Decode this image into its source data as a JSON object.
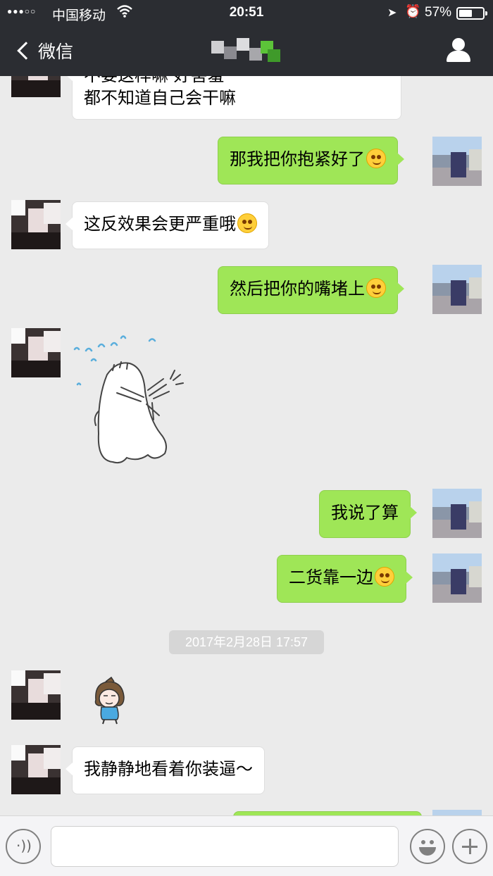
{
  "status": {
    "signal": "●●●○○",
    "carrier": "中国移动",
    "time": "20:51",
    "battery_pct": "57%",
    "battery_level": 0.57
  },
  "nav": {
    "back_label": "微信",
    "title_color_accent": "#5cc439"
  },
  "messages": [
    {
      "side": "left",
      "text_line1": "不要这样嘛 好害羞",
      "text_line2": "都不知道自己会干嘛",
      "partial": true
    },
    {
      "side": "right",
      "text": "那我把你抱紧好了",
      "emoji": "heart-eyes-emoji"
    },
    {
      "side": "left",
      "text": "这反效果会更严重哦",
      "emoji": "grin-emoji"
    },
    {
      "side": "right",
      "text": "然后把你的嘴堵上",
      "emoji": "heart-eyes-emoji"
    },
    {
      "side": "left",
      "sticker": "crying-cartoon-sticker"
    },
    {
      "side": "right",
      "text": "我说了算"
    },
    {
      "side": "right",
      "text": "二货靠一边",
      "emoji": "eye-roll-emoji"
    },
    {
      "timestamp": "2017年2月28日 17:57"
    },
    {
      "side": "left",
      "sticker": "girl-cartoon-sticker"
    },
    {
      "side": "left",
      "text": "我静静地看着你装逼～"
    }
  ],
  "colors": {
    "bar_bg": "#2b2d32",
    "chat_bg": "#ebebeb",
    "bubble_me": "#9fe657",
    "bubble_them": "#ffffff"
  },
  "input": {
    "placeholder": ""
  }
}
